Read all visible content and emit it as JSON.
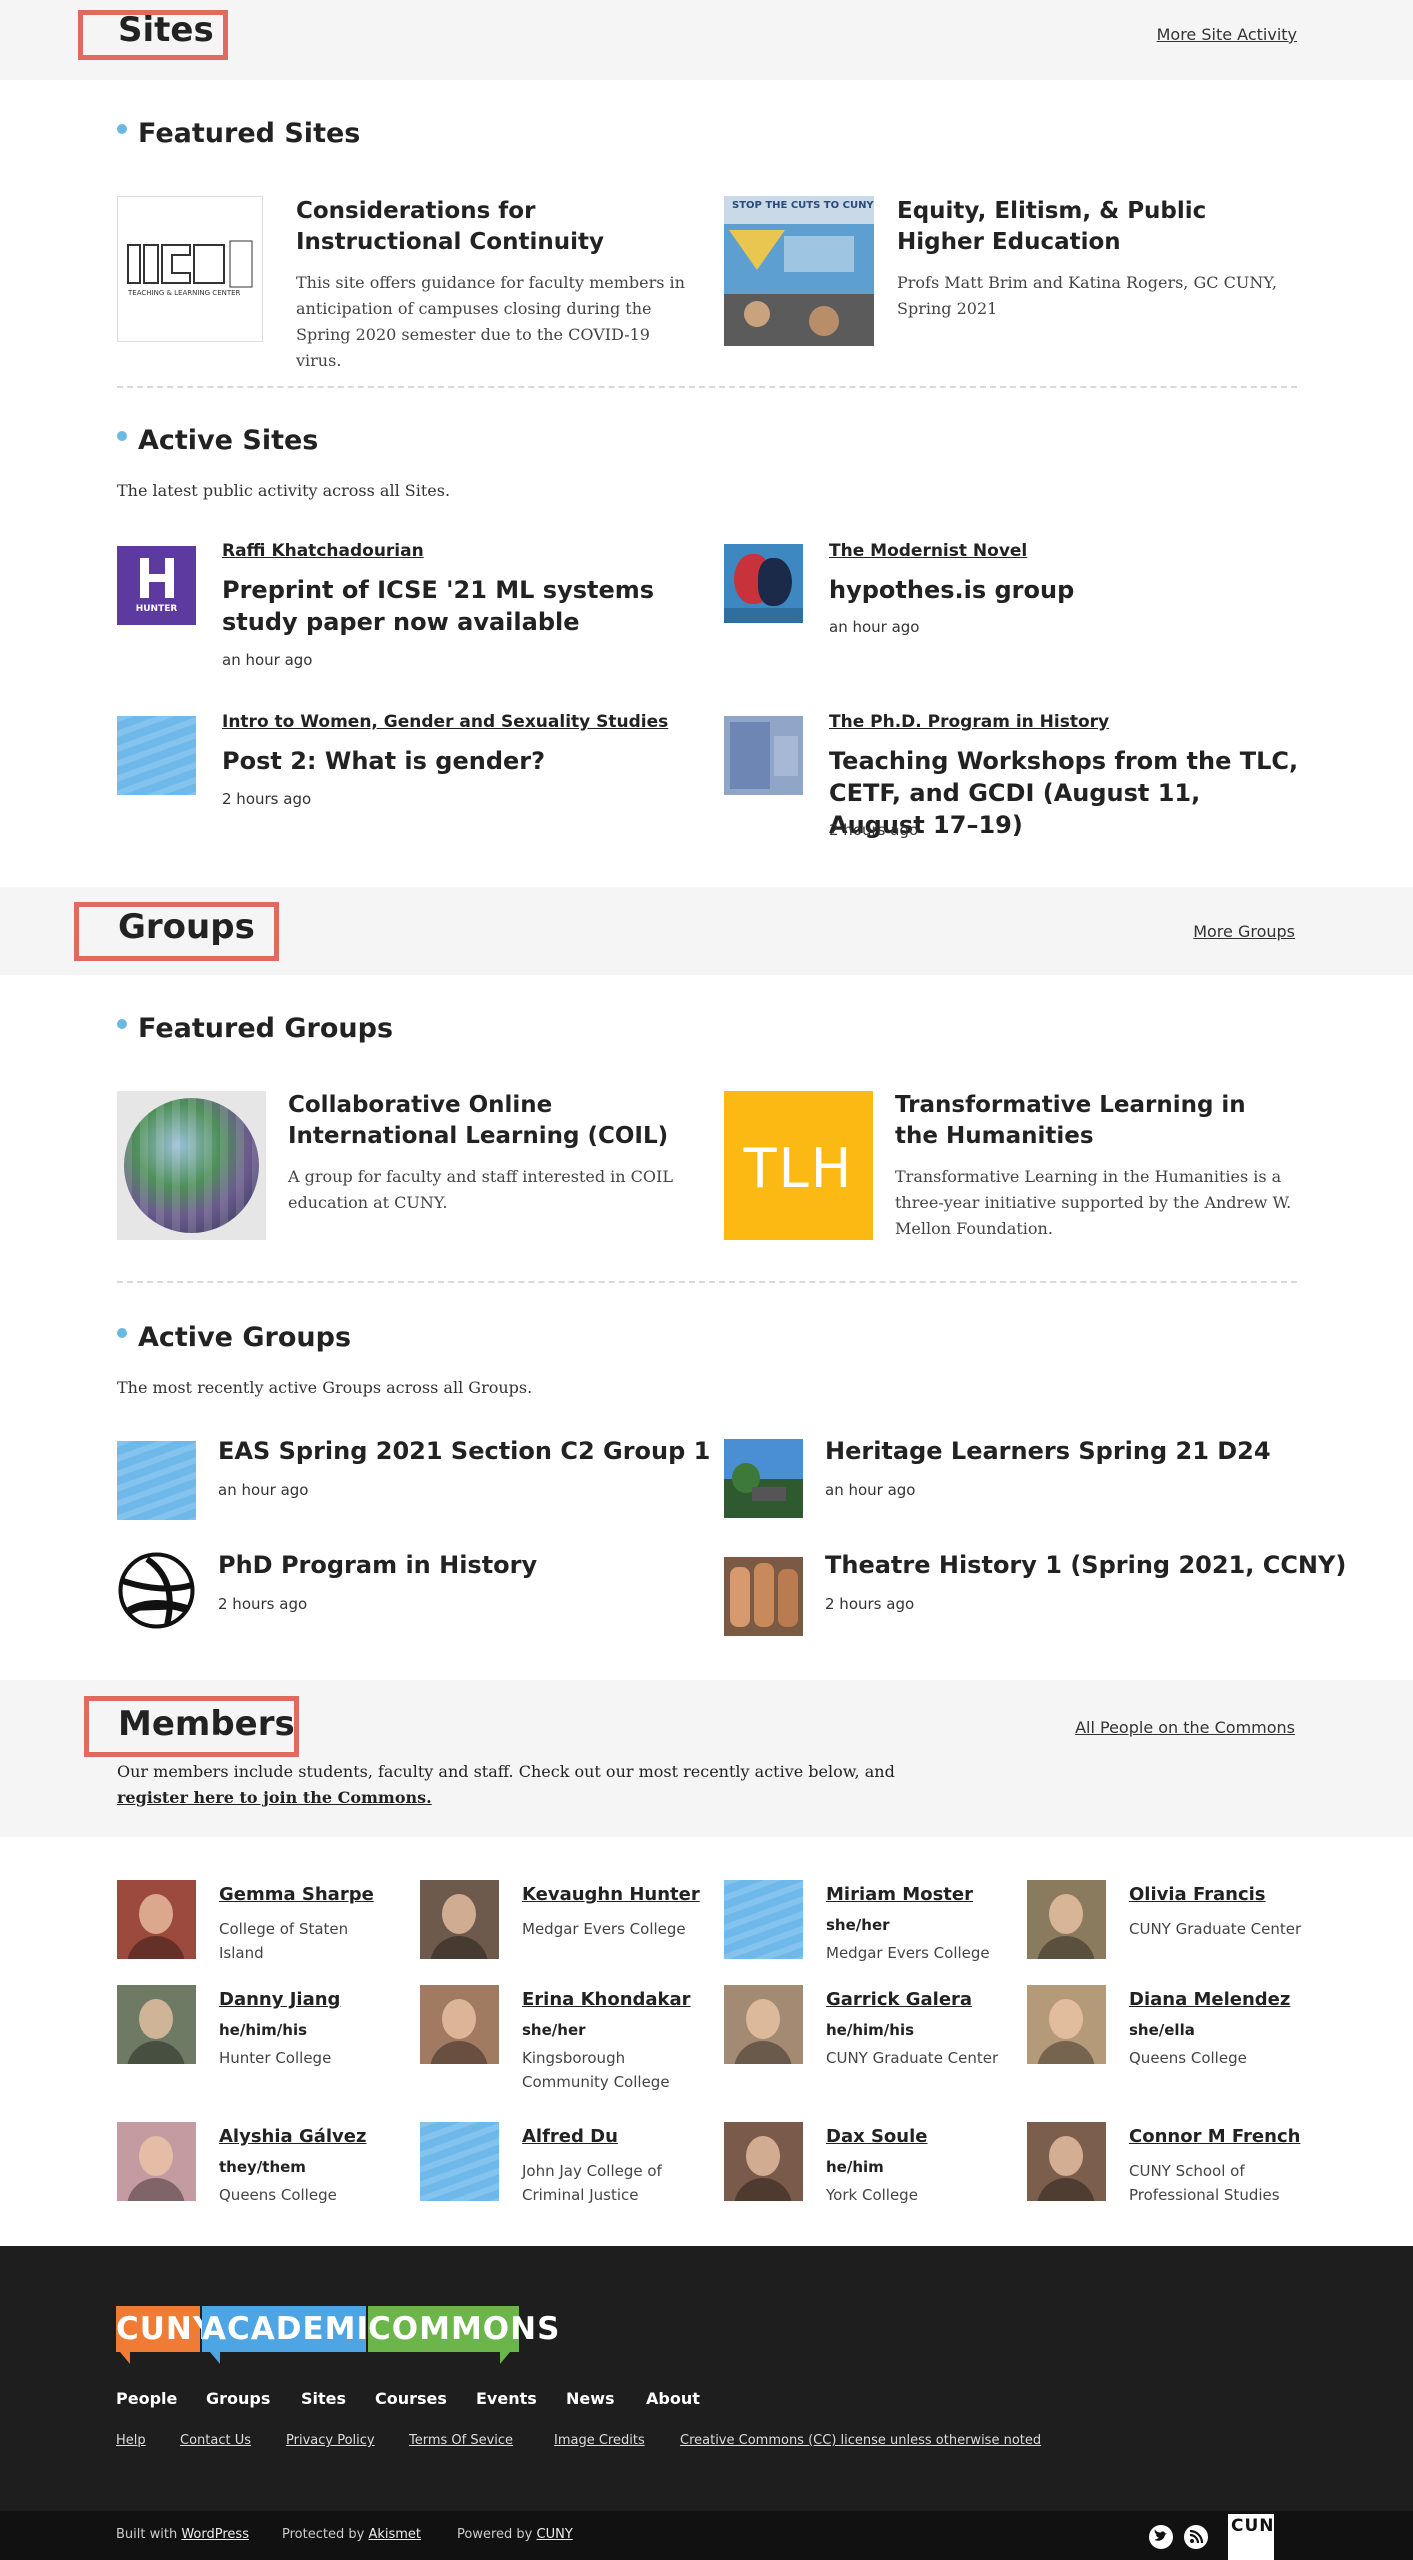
{
  "sites": {
    "title": "Sites",
    "more_link": "More Site Activity",
    "featured_heading": "Featured Sites",
    "featured": [
      {
        "title": "Considerations for Instructional Continuity",
        "text": "This site offers guidance for faculty members in anticipation of campuses closing during the Spring 2020 semester due to the COVID-19 virus.",
        "thumb_text": "TEACHING & LEARNING CENTER"
      },
      {
        "title": "Equity, Elitism, & Public Higher Education",
        "text": "Profs Matt Brim and Katina Rogers, GC CUNY, Spring 2021",
        "thumb_text": "STOP THE CUTS TO CUNY"
      }
    ],
    "active_heading": "Active Sites",
    "active_desc": "The latest public activity across all Sites.",
    "active": [
      {
        "author": "Raffi Khatchadourian",
        "title": "Preprint of ICSE '21 ML systems study paper now available",
        "time": "an hour ago",
        "thumb_text": "HUNTER"
      },
      {
        "author": "The Modernist Novel",
        "title": "hypothes.is group",
        "time": "an hour ago"
      },
      {
        "author": "Intro to Women, Gender and Sexuality Studies",
        "title": "Post 2: What is gender?",
        "time": "2 hours ago"
      },
      {
        "author": "The Ph.D. Program in History",
        "title": "Teaching Workshops from the TLC, CETF, and GCDI (August 11, August 17–19)",
        "time": "2 hours ago"
      }
    ]
  },
  "groups": {
    "title": "Groups",
    "more_link": "More Groups",
    "featured_heading": "Featured Groups",
    "featured": [
      {
        "title": "Collaborative Online International Learning (COIL)",
        "text": "A group for faculty and staff interested in COIL education at CUNY."
      },
      {
        "title": "Transformative Learning in the Humanities",
        "text": "Transformative Learning in the Humanities is a three-year initiative supported by the Andrew W. Mellon Foundation.",
        "thumb_text": "TLH"
      }
    ],
    "active_heading": "Active Groups",
    "active_desc": "The most recently active Groups across all Groups.",
    "active": [
      {
        "title": "EAS Spring 2021 Section C2 Group 1",
        "time": "an hour ago"
      },
      {
        "title": "Heritage Learners Spring 21 D24",
        "time": "an hour ago"
      },
      {
        "title": "PhD Program in History",
        "time": "2 hours ago"
      },
      {
        "title": "Theatre History 1 (Spring 2021, CCNY)",
        "time": "2 hours ago"
      }
    ]
  },
  "members": {
    "title": "Members",
    "more_link": "All People on the Commons",
    "intro": "Our members include students, faculty and staff. Check out our most recently active below, and",
    "register_link": "register here to join the Commons.",
    "list": [
      {
        "name": "Gemma Sharpe",
        "pronouns": "",
        "college": "College of Staten Island"
      },
      {
        "name": "Kevaughn Hunter",
        "pronouns": "",
        "college": "Medgar Evers College"
      },
      {
        "name": "Miriam Moster",
        "pronouns": "she/her",
        "college": "Medgar Evers College"
      },
      {
        "name": "Olivia Francis",
        "pronouns": "",
        "college": "CUNY Graduate Center"
      },
      {
        "name": "Danny Jiang",
        "pronouns": "he/him/his",
        "college": "Hunter College"
      },
      {
        "name": "Erina Khondakar",
        "pronouns": "she/her",
        "college": "Kingsborough Community College"
      },
      {
        "name": "Garrick Galera",
        "pronouns": "he/him/his",
        "college": "CUNY Graduate Center"
      },
      {
        "name": "Diana Melendez",
        "pronouns": "she/ella",
        "college": "Queens College"
      },
      {
        "name": "Alyshia Gálvez",
        "pronouns": "they/them",
        "college": "Queens College"
      },
      {
        "name": "Alfred Du",
        "pronouns": "",
        "college": "John Jay College of Criminal Justice"
      },
      {
        "name": "Dax Soule",
        "pronouns": "he/him",
        "college": "York College"
      },
      {
        "name": "Connor M French",
        "pronouns": "",
        "college": "CUNY School of Professional Studies"
      }
    ]
  },
  "footer": {
    "logo": [
      "CUNY",
      "ACADEMIC",
      "COMMONS"
    ],
    "logo_colors": [
      "#f07b35",
      "#4da5e4",
      "#6cb54b"
    ],
    "nav": [
      "People",
      "Groups",
      "Sites",
      "Courses",
      "Events",
      "News",
      "About"
    ],
    "links": [
      "Help",
      "Contact Us",
      "Privacy Policy",
      "Terms Of Sevice",
      "Image Credits",
      "Creative Commons (CC) license unless otherwise noted"
    ],
    "built_with": "Built with",
    "built_link": "WordPress",
    "protected_by": "Protected by",
    "protected_link": "Akismet",
    "powered_by": "Powered by",
    "powered_link": "CUNY",
    "icons": [
      "twitter-icon",
      "rss-icon"
    ],
    "cuny_mark": "CUNY"
  },
  "colors": {
    "accent_dot": "#6bb8e3",
    "highlight_box": "#e06a5e",
    "band": "#f5f5f5",
    "footer": "#1e1e1e"
  }
}
